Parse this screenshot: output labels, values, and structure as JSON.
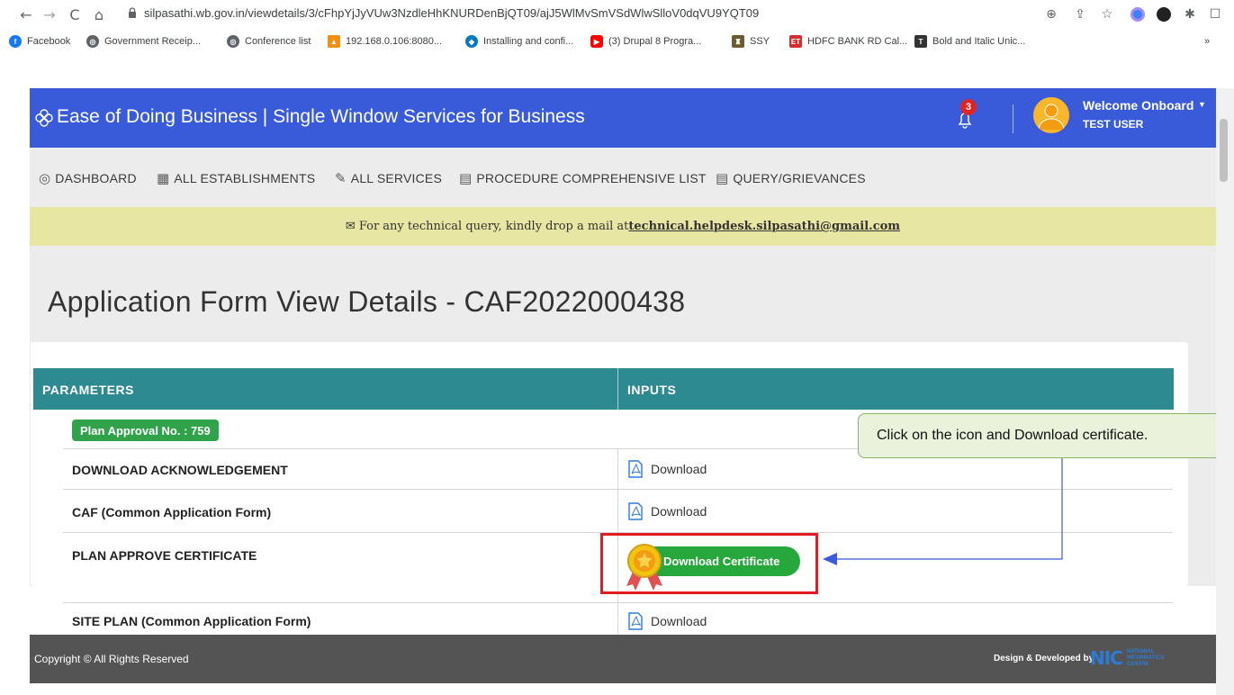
{
  "browser": {
    "url": "silpasathi.wb.gov.in/viewdetails/3/cFhpYjJyVUw3NzdleHhKNURDenBjQT09/ajJ5WlMvSmVSdWlwSlloV0dqVU9YQT09",
    "nav_back": "←",
    "nav_forward": "→",
    "nav_reload": "C",
    "nav_home": "⌂",
    "bookmarks": [
      {
        "label": "Facebook",
        "icon": "facebook-icon",
        "color": "#1877f2"
      },
      {
        "label": "Government Receip...",
        "icon": "globe-icon",
        "color": "#5f6368"
      },
      {
        "label": "Conference list",
        "icon": "globe-icon",
        "color": "#5f6368"
      },
      {
        "label": "192.168.0.106:8080...",
        "icon": "pma-icon",
        "color": "#f29111"
      },
      {
        "label": "Installing and confi...",
        "icon": "drupal-icon",
        "color": "#0678be"
      },
      {
        "label": "(3) Drupal 8 Progra...",
        "icon": "youtube-icon",
        "color": "#ff0000"
      },
      {
        "label": "SSY",
        "icon": "emblem-icon",
        "color": "#6b5b2e"
      },
      {
        "label": "HDFC BANK RD Cal...",
        "icon": "et-icon",
        "color": "#d32f2f"
      },
      {
        "label": "Bold and Italic Unic...",
        "icon": "text-icon",
        "color": "#333333"
      }
    ],
    "bookmarks_more": "»"
  },
  "header": {
    "title": "Ease of Doing Business | Single Window Services for Business",
    "notification_count": "3",
    "welcome": "Welcome Onboard",
    "user_name": "TEST USER",
    "bg_color": "#3a5bd9"
  },
  "menu": {
    "items": [
      {
        "label": "DASHBOARD",
        "icon": "dashboard-icon"
      },
      {
        "label": "ALL ESTABLISHMENTS",
        "icon": "building-icon"
      },
      {
        "label": "ALL SERVICES",
        "icon": "wrench-icon"
      },
      {
        "label": "PROCEDURE COMPREHENSIVE LIST",
        "icon": "list-icon"
      },
      {
        "label": "QUERY/GRIEVANCES",
        "icon": "list-icon"
      }
    ]
  },
  "notice": {
    "text": "For any technical query, kindly drop a mail at ",
    "email": "technical.helpdesk.silpasathi@gmail.com"
  },
  "page": {
    "title": "Application Form View Details - CAF2022000438"
  },
  "table": {
    "headers": {
      "parameters": "PARAMETERS",
      "inputs": "INPUTS"
    },
    "plan_approval": "Plan Approval No. : 759",
    "rows": [
      {
        "parameter": "DOWNLOAD ACKNOWLEDGEMENT",
        "input": "Download"
      },
      {
        "parameter": "CAF (Common Application Form)",
        "input": "Download"
      },
      {
        "parameter": "PLAN APPROVE CERTIFICATE",
        "input": "Download Certificate"
      },
      {
        "parameter": "SITE PLAN (Common Application Form)",
        "input": "Download"
      }
    ],
    "header_color": "#2d8a91"
  },
  "callout": {
    "text": "Click on the icon and Download certificate."
  },
  "footer": {
    "copyright": "Copyright © All Rights Reserved",
    "developed_by": "Design & Developed by",
    "nic_logo": "NIC",
    "nic_sub": "NATIONAL INFORMATICS CENTRE"
  }
}
